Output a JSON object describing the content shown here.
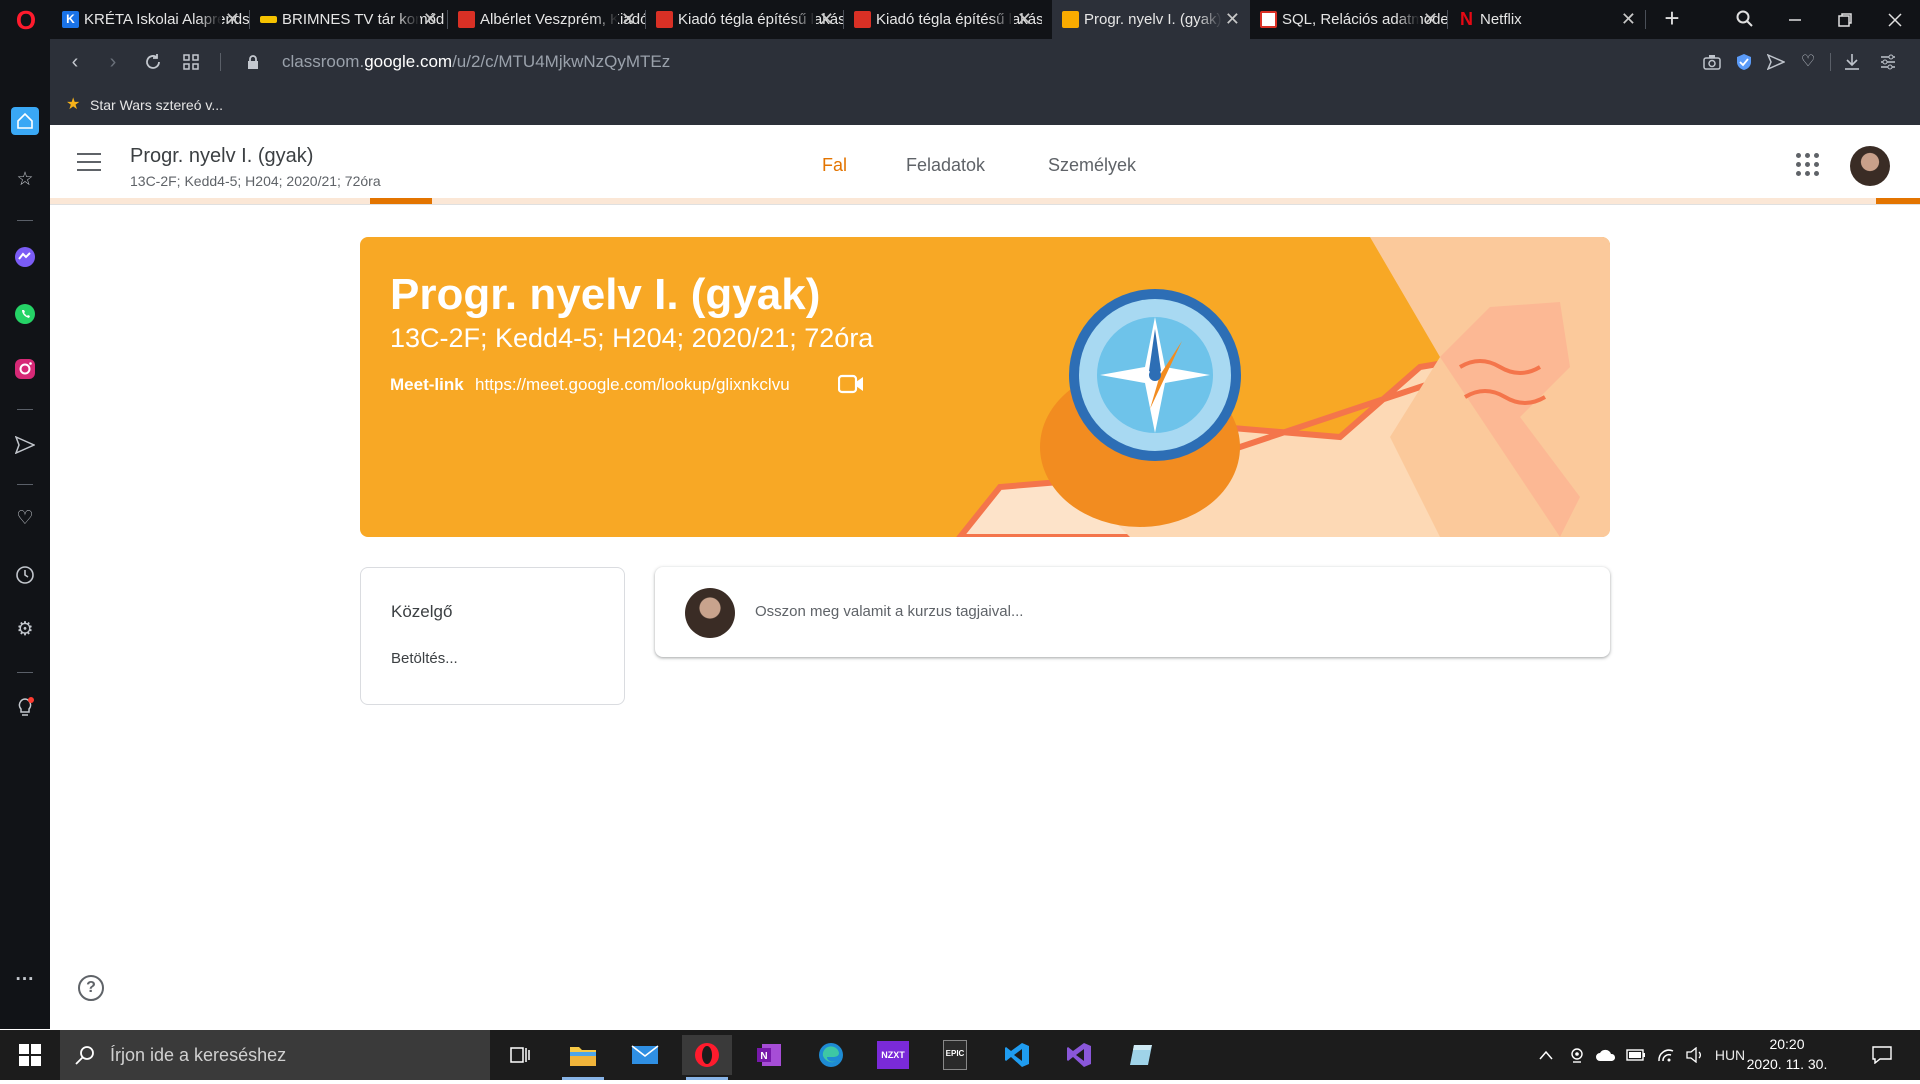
{
  "browser": {
    "tabs": [
      {
        "title": "KRÉTA Iskolai Alaprendszer",
        "favicon_color": "#1a73e8",
        "favicon_glyph": "K"
      },
      {
        "title": "BRIMNES TV tár komód",
        "favicon_color": "#f5c200",
        "favicon_glyph": ""
      },
      {
        "title": "Albérlet Veszprém, Kiadó",
        "favicon_color": "#d93025",
        "favicon_glyph": ""
      },
      {
        "title": "Kiadó tégla építésű lakás",
        "favicon_color": "#d93025",
        "favicon_glyph": ""
      },
      {
        "title": "Kiadó tégla építésű lakás",
        "favicon_color": "#d93025",
        "favicon_glyph": ""
      },
      {
        "title": "Progr. nyelv I. (gyak)",
        "favicon_color": "#f9ab00",
        "favicon_glyph": ""
      },
      {
        "title": "SQL, Relációs adatmodell",
        "favicon_color": "#ffffff",
        "favicon_glyph": ""
      },
      {
        "title": "Netflix",
        "favicon_color": "#e50914",
        "favicon_glyph": "N"
      }
    ],
    "active_tab_index": 5,
    "url_prefix": "classroom.",
    "url_domain": "google.com",
    "url_path": "/u/2/c/MTU4MjkwNzQyMTEz",
    "bookmark": "Star Wars sztereó v..."
  },
  "classroom": {
    "course_name": "Progr. nyelv I. (gyak)",
    "course_sub": "13C-2F; Kedd4-5; H204; 2020/21; 72óra",
    "nav_tabs": [
      "Fal",
      "Feladatok",
      "Személyek"
    ],
    "active_nav": "Fal",
    "banner": {
      "title": "Progr. nyelv I. (gyak)",
      "subtitle": "13C-2F; Kedd4-5; H204; 2020/21; 72óra",
      "meet_label": "Meet-link",
      "meet_url": "https://meet.google.com/lookup/glixnkclvu",
      "color": "#f8a825"
    },
    "upcoming": {
      "title": "Közelgő",
      "status": "Betöltés..."
    },
    "share_placeholder": "Osszon meg valamit a kurzus tagjaival..."
  },
  "taskbar": {
    "search_placeholder": "Írjon ide a kereséshez",
    "apps": [
      "task-view",
      "file-explorer",
      "mail",
      "opera",
      "onenote",
      "edge",
      "nzxt",
      "epic-games",
      "vscode",
      "visual-studio",
      "notes"
    ],
    "nzxt_label": "NZXT",
    "epic_label": "EPIC",
    "language": "HUN",
    "time": "20:20",
    "date": "2020. 11. 30."
  }
}
